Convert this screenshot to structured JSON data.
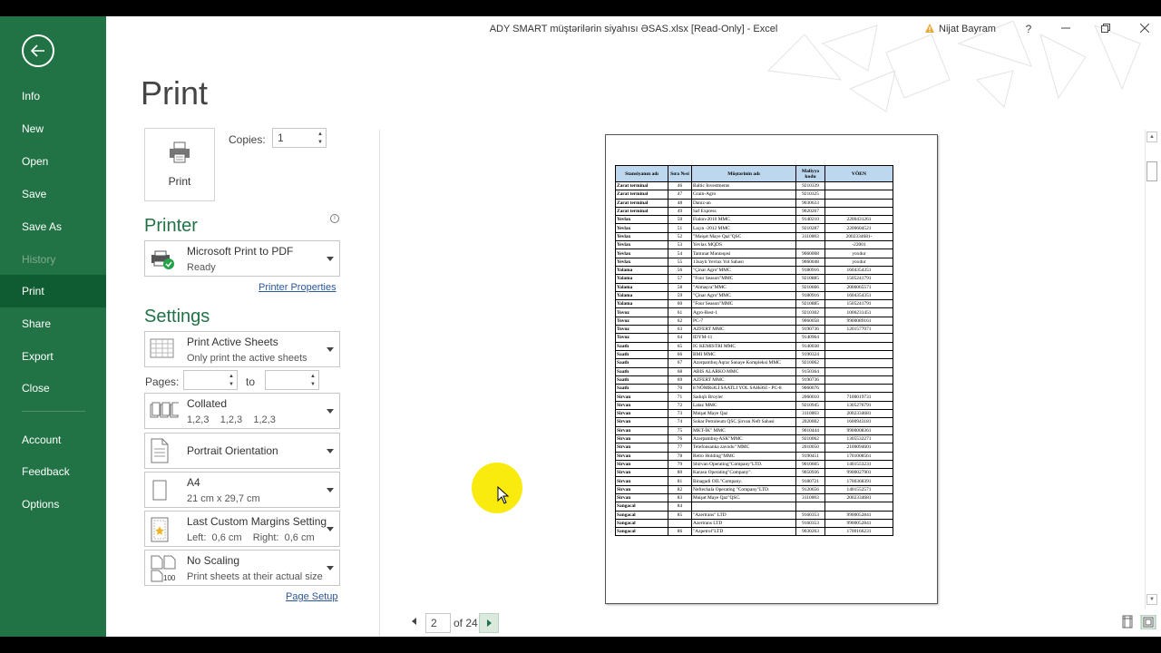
{
  "window": {
    "title": "ADY SMART müştərilərin siyahısı ƏSAS.xlsx  [Read-Only]  -  Excel",
    "user": "Nijat Bayram",
    "help": "?"
  },
  "nav": {
    "items": [
      {
        "label": "Info",
        "state": "normal"
      },
      {
        "label": "New",
        "state": "normal"
      },
      {
        "label": "Open",
        "state": "normal"
      },
      {
        "label": "Save",
        "state": "normal"
      },
      {
        "label": "Save As",
        "state": "normal"
      },
      {
        "label": "History",
        "state": "disabled"
      },
      {
        "label": "Print",
        "state": "active"
      },
      {
        "label": "Share",
        "state": "normal"
      },
      {
        "label": "Export",
        "state": "normal"
      },
      {
        "label": "Close",
        "state": "normal"
      },
      {
        "label": "Account",
        "state": "normal"
      },
      {
        "label": "Feedback",
        "state": "normal"
      },
      {
        "label": "Options",
        "state": "normal"
      }
    ]
  },
  "print": {
    "heading": "Print",
    "button_label": "Print",
    "copies_label": "Copies:",
    "copies_value": "1",
    "printer_heading": "Printer",
    "printer_name": "Microsoft Print to PDF",
    "printer_status": "Ready",
    "printer_properties": "Printer Properties",
    "settings_heading": "Settings",
    "pages_label": "Pages:",
    "to_label": "to",
    "page_setup": "Page Setup",
    "settings": [
      {
        "title": "Print Active Sheets",
        "sub": "Only print the active sheets"
      },
      {
        "title": "Collated",
        "sub": "1,2,3    1,2,3    1,2,3"
      },
      {
        "title": "Portrait Orientation",
        "sub": ""
      },
      {
        "title": "A4",
        "sub": "21 cm x 29,7 cm"
      },
      {
        "title": "Last Custom Margins Setting",
        "sub": "Left:  0,6 cm    Right:  0,6 cm"
      },
      {
        "title": "No Scaling",
        "sub": "Print sheets at their actual size"
      }
    ]
  },
  "pager": {
    "current": "2",
    "of_text": "of 24"
  },
  "sheet": {
    "headers": [
      "Stansiyanın adı",
      "Sıra №si",
      "Müştərinin adı",
      "Maliyyə kodu",
      "VÖEN"
    ],
    "rows": [
      [
        "Zarat terminal",
        "46",
        "Baltic Investments",
        "9210339",
        ""
      ],
      [
        "Zarat terminal",
        "47",
        "Grain-Agro",
        "9210325",
        ""
      ],
      [
        "Zarat terminal",
        "48",
        "Danız-an",
        "9030633",
        ""
      ],
      [
        "Zarat terminal",
        "49",
        "Saf Express",
        "9020267",
        ""
      ],
      [
        "Yevlax",
        "50",
        "Fialon-2010 MMC",
        "9140210",
        "2200431261"
      ],
      [
        "Yevlax",
        "51",
        "Laçın -2012 MMC",
        "9210287",
        "2200604521"
      ],
      [
        "Yevlax",
        "52",
        "\"Məişət Maye Qaz\"QSC",
        "3110003",
        "2002334681-"
      ],
      [
        "Yevlax",
        "53",
        "Yevlax MQDS",
        "",
        "-22001"
      ],
      [
        "Yevlax",
        "54",
        "Tamınat Məntəqəsi",
        "9060008",
        "yoxdur"
      ],
      [
        "Yevlax",
        "55",
        "13saylı Yevlax Yol Sahəsi",
        "9060048",
        "yoxdur"
      ],
      [
        "Yalama",
        "56",
        "\"Çinar Agro\"MMC",
        "9180916",
        "1604354351"
      ],
      [
        "Yalama",
        "57",
        "\"Four Season\"MMC",
        "9210885",
        "1505241791"
      ],
      [
        "Yalama",
        "58",
        "\"Almaşva\"MMC",
        "9210666",
        "2006065571"
      ],
      [
        "Yalama",
        "59",
        "\"Çinar Agro\"MMC",
        "9180916",
        "1604354351"
      ],
      [
        "Yalama",
        "60",
        "\"Four Season\"MMC",
        "9210885",
        "1505241791"
      ],
      [
        "Tovuz",
        "61",
        "Agro-Best-1",
        "9210302",
        "1006231451"
      ],
      [
        "Tovuz",
        "62",
        "PC-7",
        "9060058",
        "9900089161"
      ],
      [
        "Tovuz",
        "63",
        "AZFERT  MMC",
        "9190736",
        "1201577071"
      ],
      [
        "Tovuz",
        "64",
        "IDYM-11",
        "9140964",
        ""
      ],
      [
        "Saatlı",
        "65",
        "IG KEMISTRI MMC",
        "9140038",
        ""
      ],
      [
        "Saatlı",
        "66",
        "BMI MMC",
        "9190324",
        ""
      ],
      [
        "Saatlı",
        "67",
        "Azərpambıq Aqrar Sənaye Kompleksi MMC",
        "9210062",
        ""
      ],
      [
        "Saatlı",
        "68",
        "ABIS ALARKO MMC",
        "9150364",
        ""
      ],
      [
        "Saatlı",
        "69",
        "AZFERT MMC",
        "9190736",
        ""
      ],
      [
        "Saatlı",
        "70",
        "8 NÖMRƏLİ SAATLI YOL SAHƏSİ - PC-8",
        "9060076",
        ""
      ],
      [
        "Sirvan",
        "71",
        "Sadıqlı Broyler",
        "2060010",
        "7100019731"
      ],
      [
        "Sirvan",
        "72",
        "Lataz  MMC",
        "9210945",
        "1305276791"
      ],
      [
        "Sirvan",
        "73",
        "Məişət Maye Qaz",
        "3110003",
        "2002334681"
      ],
      [
        "Sirvan",
        "74",
        "Sokar Petroleum QSC Şirvan Neft Sahəsi",
        "2020002",
        "1600943181"
      ],
      [
        "Sirvan",
        "75",
        "MKT-İK\" MMC",
        "9010444",
        "9900008361"
      ],
      [
        "Sirvan",
        "76",
        "Azərpambıq-ASK\"MMC",
        "9210062",
        "1305532271"
      ],
      [
        "Sirvan",
        "77",
        "Telefonsanka zavodu\" MMC",
        "2010050",
        "2100094601"
      ],
      [
        "Sirvan",
        "78",
        "Retro Holding\"MMC",
        "9190451",
        "1701008561"
      ],
      [
        "Sirvan",
        "79",
        "Shirvan Operating\"Company\"LTD.",
        "9010605",
        "1401553231"
      ],
      [
        "Sirvan",
        "80",
        "Karasu Operating\"Company\".",
        "9050936",
        "9900027901"
      ],
      [
        "Sirvan",
        "81",
        "Binagadi OIL\"Company.",
        "9180721",
        "1700368391"
      ],
      [
        "Sirvan",
        "82",
        "Neftechala Operating \"Company\"LTD.",
        "9120656",
        "1401552571"
      ],
      [
        "Sirvan",
        "83",
        "Məişət Maye Qaz\"QSC.",
        "3110003",
        "2002334681"
      ],
      [
        "Sangacal",
        "84",
        "",
        "",
        ""
      ],
      [
        "Sangacal",
        "85",
        "\"Azertrans\" LTD",
        "9160353",
        "9900052841"
      ],
      [
        "Sangacal",
        "",
        "Azertrans LTD",
        "9160353",
        "9900052841"
      ],
      [
        "Sangacal",
        "86",
        "\"Azpetrol\"LTD",
        "9030263",
        "1700166231"
      ]
    ]
  }
}
